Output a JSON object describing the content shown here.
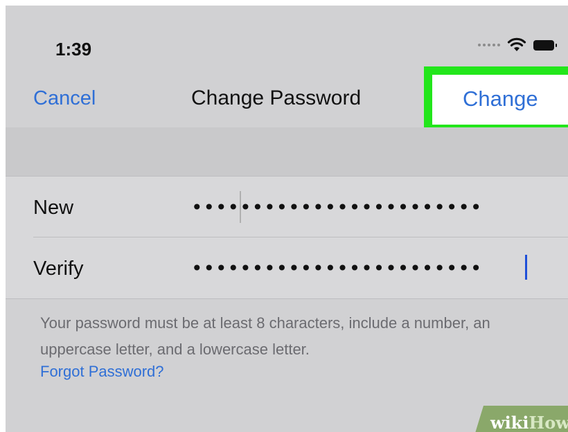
{
  "status_bar": {
    "time": "1:39",
    "icons": [
      "signal-dots-icon",
      "wifi-icon",
      "battery-icon"
    ]
  },
  "nav": {
    "cancel_label": "Cancel",
    "title": "Change Password",
    "change_label": "Change",
    "highlight_color": "#22e61b",
    "accent_color": "#2f6fd6"
  },
  "form": {
    "new_label": "New",
    "new_value": "••••••••••••••••••••••••",
    "verify_label": "Verify",
    "verify_value": "••••••••••••••••••••••••"
  },
  "footer": {
    "hint": "Your password must be at least 8 characters, include a number, an uppercase letter, and a lowercase letter.",
    "forgot_label": "Forgot Password?"
  },
  "watermark": {
    "part1": "wiki",
    "part2": "How"
  }
}
